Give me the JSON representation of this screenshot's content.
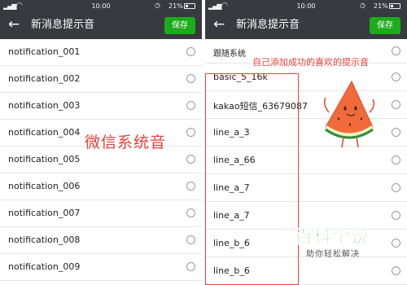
{
  "left_screen": {
    "status": {
      "time": "10:00",
      "battery": "21%"
    },
    "header": {
      "title": "新消息提示音",
      "back_icon": "arrow-left-icon",
      "save_label": "保存"
    },
    "items": [
      "notification_001",
      "notification_002",
      "notification_003",
      "notification_004",
      "notification_005",
      "notification_006",
      "notification_007",
      "notification_008",
      "notification_009"
    ],
    "annotation": "微信系统音"
  },
  "right_screen": {
    "status": {
      "time": "10:00",
      "battery": "21%"
    },
    "header": {
      "title": "新消息提示音",
      "back_icon": "arrow-left-icon",
      "save_label": "保存"
    },
    "section_label": "跟随系统",
    "annotation": "自己添加成功的喜欢的提示音",
    "items": [
      "basic_5_16k",
      "kakao短信_63679087",
      "line_a_3",
      "line_a_66",
      "line_a_7",
      "line_a_7",
      "line_b_6",
      "line_b_6"
    ],
    "watermark": {
      "main": "百科全说",
      "sub": "助你轻松解决"
    }
  },
  "colors": {
    "bar": "#393a3f",
    "accent": "#1aad19",
    "annotation": "#e8403a",
    "watermark": "#2eaa4a"
  }
}
